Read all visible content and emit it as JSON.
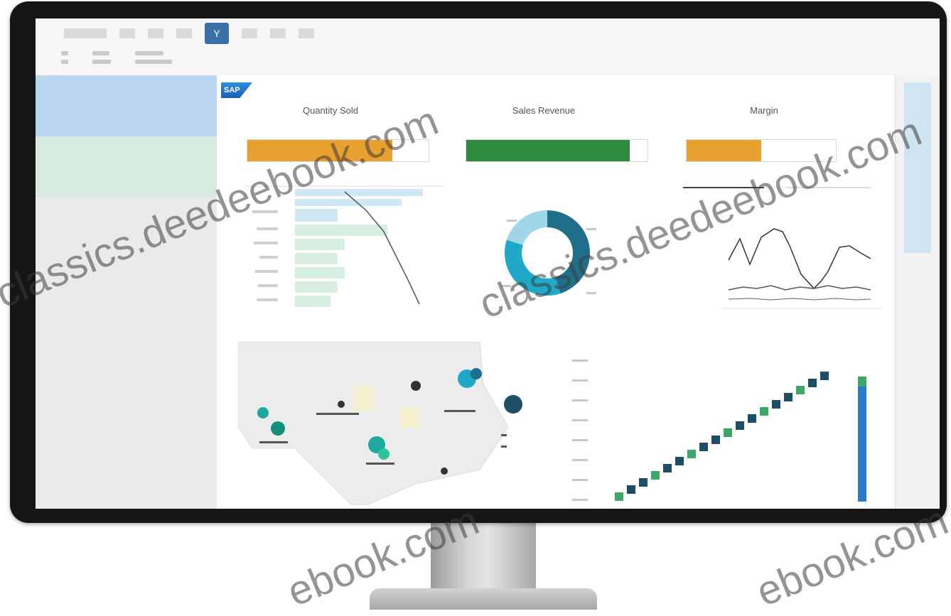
{
  "ribbon": {
    "active_tab_glyph": "Y"
  },
  "dashboard": {
    "logo_text": "SAP",
    "cards": [
      {
        "title": "Quantity Sold",
        "kpi_label": "Sold",
        "kpi_color": "#e8a030",
        "kpi_fill": 0.8
      },
      {
        "title": "Sales Revenue",
        "kpi_label": "Revenue",
        "kpi_color": "#2e8b3e",
        "kpi_fill": 0.9
      },
      {
        "title": "Margin",
        "kpi_label": "Margin",
        "kpi_color": "#e8a030",
        "kpi_fill": 0.5
      }
    ],
    "donut": {
      "segments": [
        {
          "value": 0.45,
          "color": "#1f6f8b"
        },
        {
          "value": 0.35,
          "color": "#1fa8c8"
        },
        {
          "value": 0.2,
          "color": "#9fd6e8"
        }
      ]
    },
    "colors": {
      "accent_teal": "#1fa8a0",
      "bar_blue": "#2a78c8",
      "bar_green": "#3aa868"
    }
  },
  "watermarks": [
    "classics.deedeebook.com",
    "classics.deedeebook.com",
    "ebook.com",
    "ebook.com"
  ]
}
